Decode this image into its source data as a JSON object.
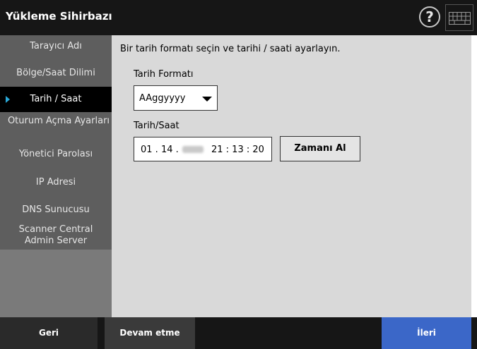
{
  "window": {
    "title": "Yükleme Sihirbazı"
  },
  "icons": {
    "help": "help-icon",
    "help_glyph": "?",
    "keyboard": "keyboard-icon"
  },
  "sidebar": {
    "items": [
      {
        "label": "Tarayıcı Adı",
        "active": false
      },
      {
        "label": "Bölge/Saat Dilimi",
        "active": false
      },
      {
        "label": "Tarih / Saat",
        "active": true
      },
      {
        "label": "Oturum Açma Ayarları",
        "active": false
      },
      {
        "label": "Yönetici Parolası",
        "active": false
      },
      {
        "label": "IP Adresi",
        "active": false
      },
      {
        "label": "DNS Sunucusu",
        "active": false
      },
      {
        "label": "Scanner Central Admin Server",
        "active": false
      }
    ]
  },
  "main": {
    "instruction": "Bir tarih formatı seçin ve tarihi / saati ayarlayın.",
    "date_format": {
      "label": "Tarih Formatı",
      "value": "AAggyyyy"
    },
    "datetime": {
      "label": "Tarih/Saat",
      "date": "01 . 14 .",
      "time": "21 : 13 : 20"
    },
    "get_time_button": "Zamanı Al"
  },
  "footer": {
    "back": "Geri",
    "continue": "Devam etme",
    "next": "İleri"
  },
  "colors": {
    "titlebar": "#161616",
    "sidebar": "#5e5e5e",
    "content": "#d9d9d9",
    "active_arrow": "#2aa9d8",
    "next_button": "#3b67c8"
  }
}
